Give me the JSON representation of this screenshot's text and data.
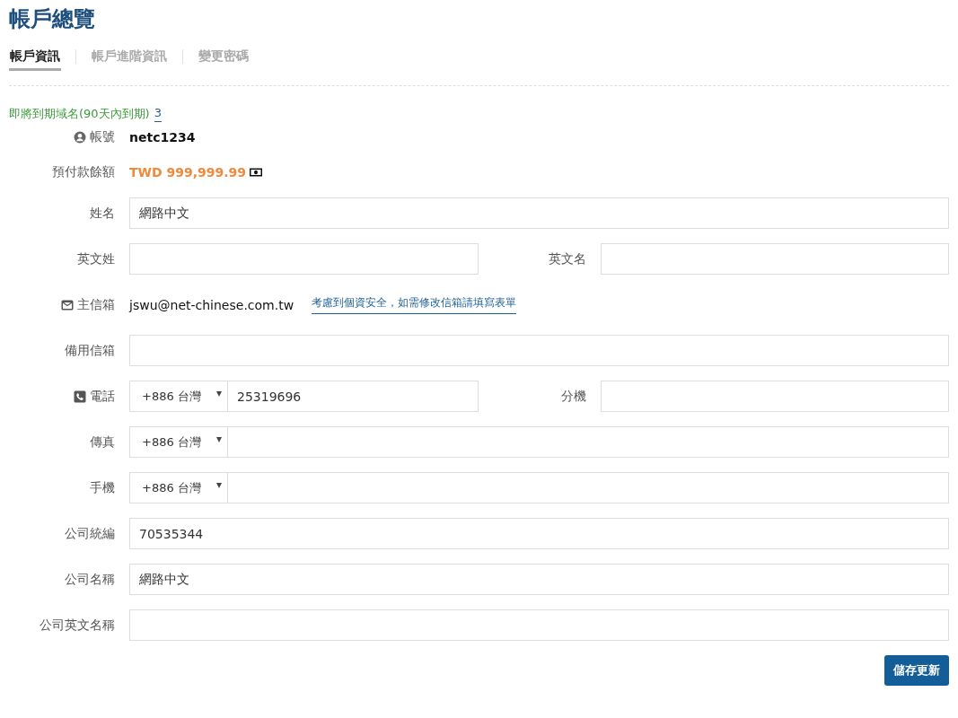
{
  "title": "帳戶總覽",
  "tabs": [
    {
      "label": "帳戶資訊",
      "selected": true
    },
    {
      "label": "帳戶進階資訊",
      "selected": false
    },
    {
      "label": "變更密碼",
      "selected": false
    }
  ],
  "notice": {
    "label": "即將到期域名(90天內到期)",
    "count": "3"
  },
  "rows": [
    {
      "kind": "account",
      "label": "帳號",
      "value": "netc1234"
    },
    {
      "kind": "balance",
      "label": "預付款餘額",
      "value": "TWD 999,999.99"
    },
    {
      "kind": "text",
      "label": "姓名",
      "value": "網路中文"
    },
    {
      "kind": "pair",
      "fields": [
        {
          "label": "英文姓"
        },
        {
          "label": "英文名"
        }
      ]
    },
    {
      "kind": "email",
      "label": "主信箱",
      "value": "jswu@net-chinese.com.tw",
      "link": "考慮到個資安全，如需修改信箱請填寫表單"
    },
    {
      "kind": "text",
      "label": "備用信箱"
    },
    {
      "kind": "phone",
      "label": "電話",
      "country": "+886 台灣",
      "value": "25319696",
      "extra": {
        "label": "分機"
      }
    },
    {
      "kind": "dial",
      "label": "傳真",
      "country": "+886 台灣"
    },
    {
      "kind": "dial",
      "label": "手機",
      "country": "+886 台灣"
    },
    {
      "kind": "text",
      "label": "公司統編",
      "value": "70535344"
    },
    {
      "kind": "text",
      "label": "公司名稱",
      "value": "網路中文"
    },
    {
      "kind": "text",
      "label": "公司英文名稱"
    }
  ],
  "save_button": "儲存更新"
}
